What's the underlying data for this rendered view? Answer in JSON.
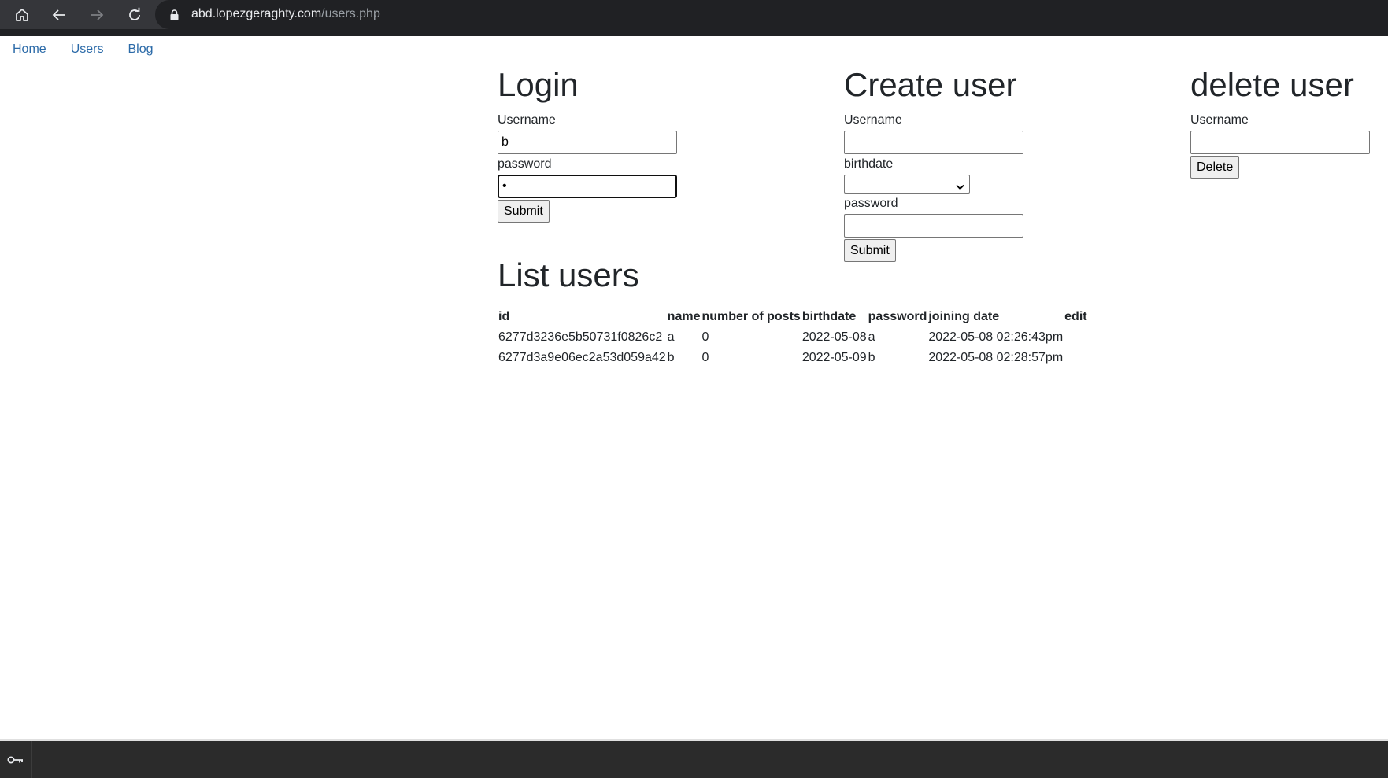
{
  "browser": {
    "url_host": "abd.lopezgeraghty.com",
    "url_path": "/users.php"
  },
  "nav": {
    "links": [
      "Home",
      "Users",
      "Blog"
    ]
  },
  "login": {
    "title": "Login",
    "username_label": "Username",
    "username_value": "b",
    "password_label": "password",
    "password_value": "•",
    "submit_label": "Submit"
  },
  "create_user": {
    "title": "Create user",
    "username_label": "Username",
    "username_value": "",
    "birthdate_label": "birthdate",
    "birthdate_value": "",
    "password_label": "password",
    "password_value": "",
    "submit_label": "Submit"
  },
  "delete_user": {
    "title": "delete user",
    "username_label": "Username",
    "username_value": "",
    "delete_label": "Delete"
  },
  "list_users": {
    "title": "List users",
    "columns": [
      "id",
      "name",
      "number of posts",
      "birthdate",
      "password",
      "joining date",
      "edit"
    ],
    "rows": [
      [
        "6277d3236e5b50731f0826c2",
        "a",
        "0",
        "2022-05-08",
        "a",
        "2022-05-08 02:26:43pm",
        ""
      ],
      [
        "6277d3a9e06ec2a53d059a42",
        "b",
        "0",
        "2022-05-09",
        "b",
        "2022-05-08 02:28:57pm",
        ""
      ]
    ]
  },
  "colors": {
    "link": "#2b6aa8",
    "chrome_bg": "#35363a",
    "text": "#212529"
  },
  "icons": [
    "home-icon",
    "back-icon",
    "forward-icon",
    "reload-icon",
    "lock-icon",
    "key-icon",
    "chevron-down-icon"
  ]
}
